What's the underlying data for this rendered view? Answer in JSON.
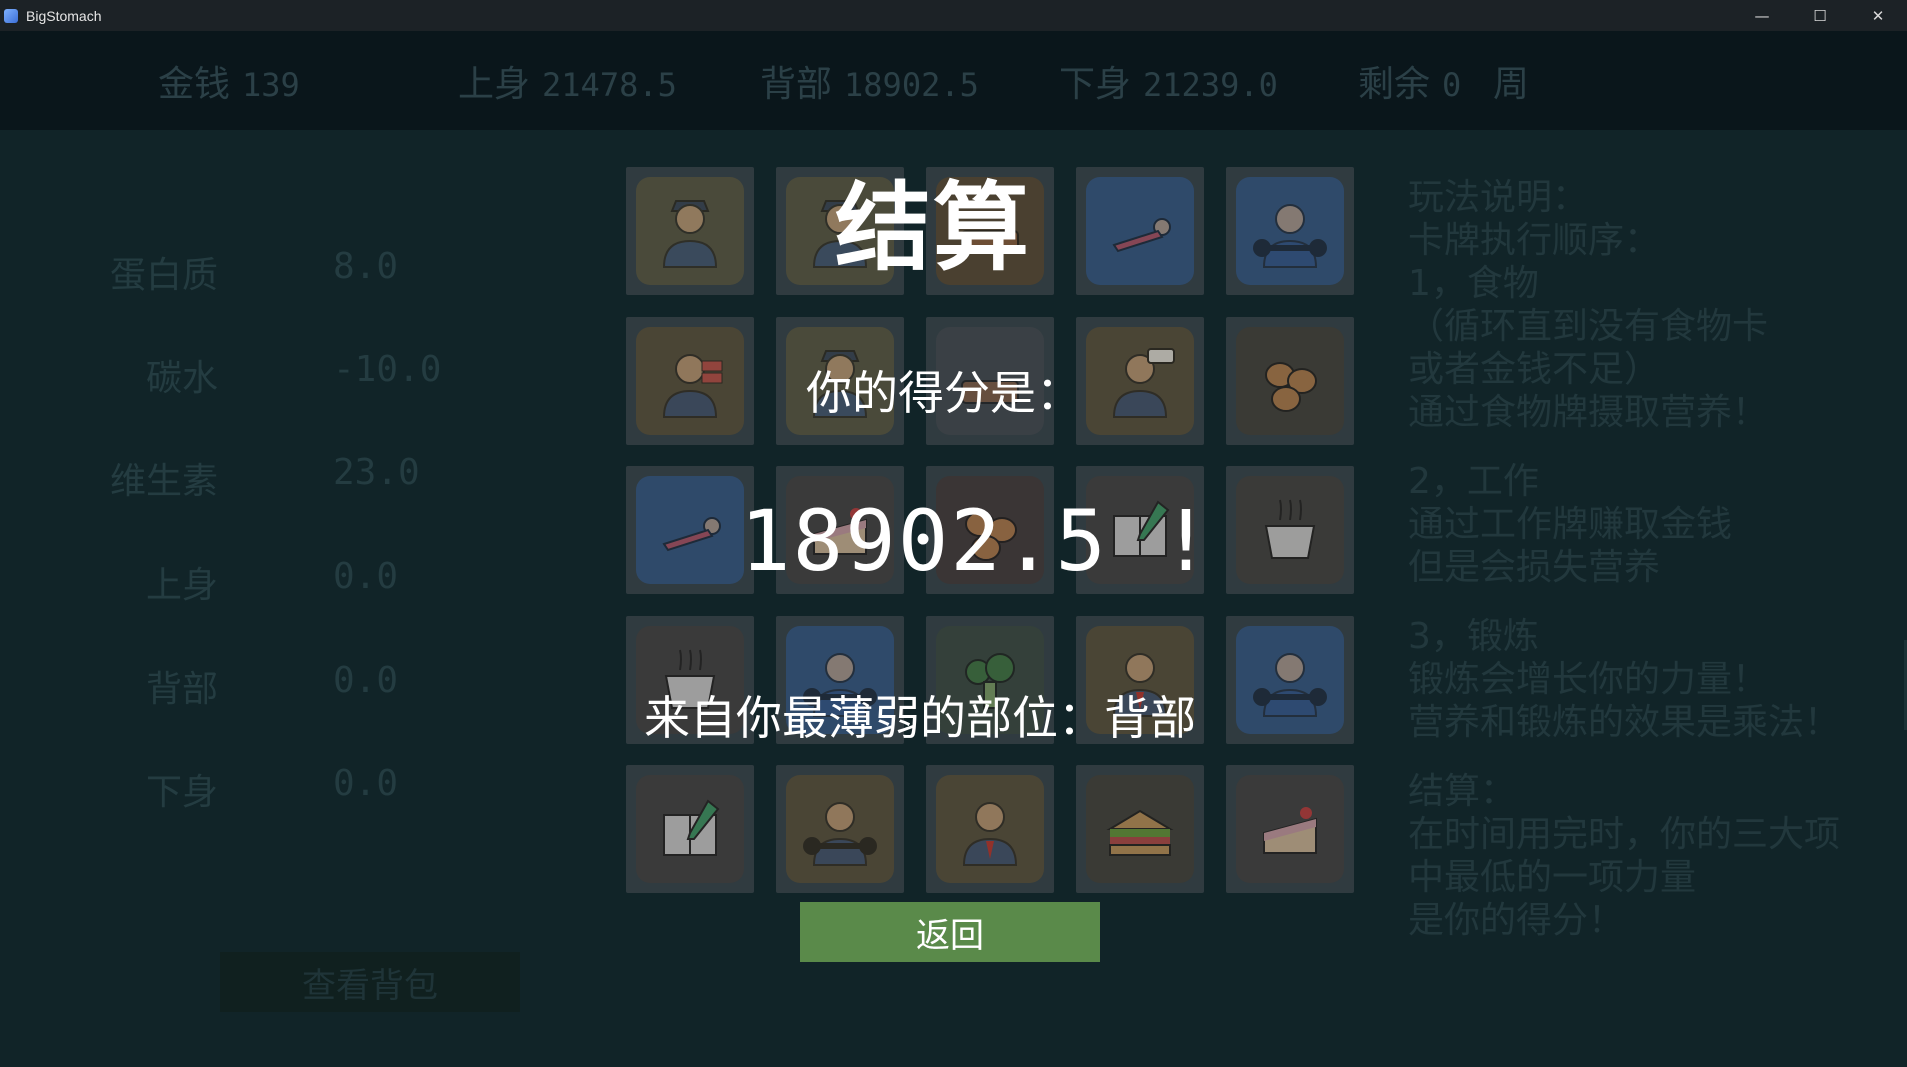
{
  "window": {
    "title": "BigStomach",
    "controls": [
      "—",
      "☐",
      "✕"
    ]
  },
  "stats": {
    "money": {
      "label": "金钱",
      "value": "139"
    },
    "upper": {
      "label": "上身",
      "value": "21478.5"
    },
    "back": {
      "label": "背部",
      "value": "18902.5"
    },
    "lower": {
      "label": "下身",
      "value": "21239.0"
    },
    "remaining": {
      "label": "剩余",
      "value": "0",
      "unit": "周"
    }
  },
  "nutrition": [
    {
      "label": "蛋白质",
      "value": "8.0"
    },
    {
      "label": "碳水",
      "value": "-10.0"
    },
    {
      "label": "维生素",
      "value": "23.0"
    },
    {
      "label": "上身",
      "value": "0.0"
    },
    {
      "label": "背部",
      "value": "0.0"
    },
    {
      "label": "下身",
      "value": "0.0"
    }
  ],
  "bag_button": "查看背包",
  "cards": [
    [
      "police-officer-icon",
      "police-officer-icon",
      "wood-plank-icon",
      "plank-exercise-icon",
      "cycling-icon"
    ],
    [
      "bricklayer-icon",
      "police-officer-icon",
      "food-item-icon",
      "livestream-icon",
      "chestnuts-icon"
    ],
    [
      "pushup-icon",
      "cake-icon",
      "sweet-potato-icon",
      "novel-writing-icon",
      "noodle-bowl-icon"
    ],
    [
      "yogurt-icon",
      "weightlifter-icon",
      "broccoli-icon",
      "office-worker-icon",
      "dumbbell-curl-icon"
    ],
    [
      "novel-writing-icon",
      "gym-coach-icon",
      "businessman-icon",
      "sandwich-icon",
      "cake-slice-icon"
    ]
  ],
  "rules": [
    "玩法说明：",
    "卡牌执行顺序：",
    "1，食物",
    "（循环直到没有食物卡",
    "或者金钱不足）",
    "通过食物牌摄取营养！",
    "",
    "2，工作",
    "通过工作牌赚取金钱",
    "但是会损失营养",
    "",
    "3，锻炼",
    "锻炼会增长你的力量！",
    "营养和锻炼的效果是乘法！",
    "",
    "结算：",
    "在时间用完时，你的三大项",
    "中最低的一项力量",
    "是你的得分！"
  ],
  "result": {
    "title": "结算",
    "score_label": "你的得分是：",
    "score": "18902.5 !",
    "weakest": "来自你最薄弱的部位：背部",
    "return_button": "返回"
  }
}
